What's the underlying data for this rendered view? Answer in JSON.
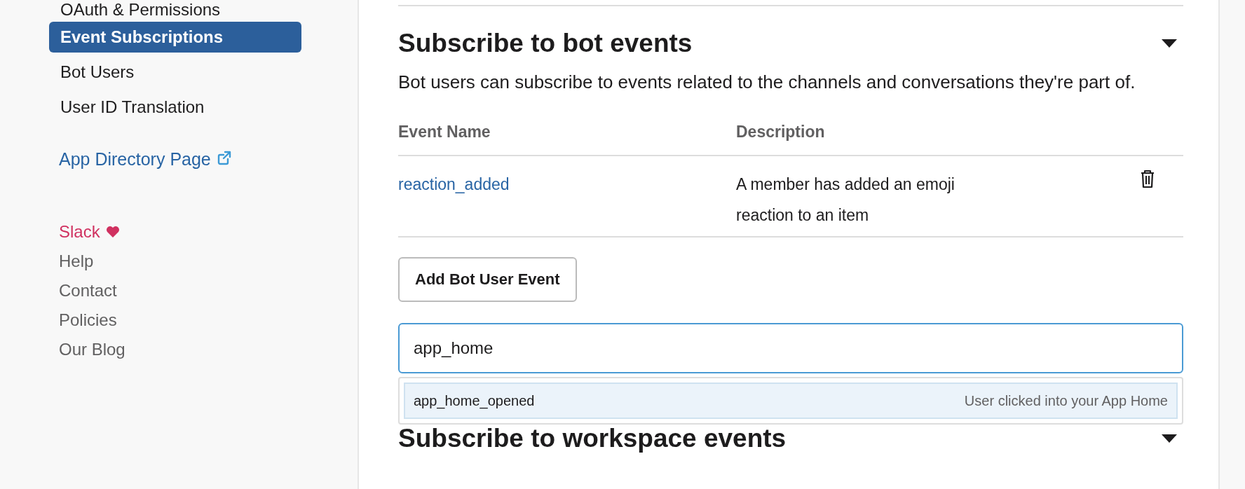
{
  "sidebar": {
    "items": [
      {
        "label": "OAuth & Permissions",
        "selected": false
      },
      {
        "label": "Event Subscriptions",
        "selected": true
      },
      {
        "label": "Bot Users",
        "selected": false
      },
      {
        "label": "User ID Translation",
        "selected": false
      }
    ],
    "directory_link": {
      "label": "App Directory Page"
    },
    "footer": [
      {
        "label": "Slack",
        "kind": "brand"
      },
      {
        "label": "Help",
        "kind": "link"
      },
      {
        "label": "Contact",
        "kind": "link"
      },
      {
        "label": "Policies",
        "kind": "link"
      },
      {
        "label": "Our Blog",
        "kind": "link"
      }
    ]
  },
  "sections": [
    {
      "title": "Subscribe to bot events",
      "expanded": true,
      "description": "Bot users can subscribe to events related to the channels and conversations they're part of.",
      "table": {
        "columns": [
          "Event Name",
          "Description"
        ],
        "rows": [
          {
            "event": "reaction_added",
            "description": "A member has added an emoji reaction to an item"
          }
        ]
      },
      "add_button": "Add Bot User Event",
      "search": {
        "value": "app_home"
      },
      "suggestions": [
        {
          "name": "app_home_opened",
          "description": "User clicked into your App Home",
          "selected": true
        }
      ]
    },
    {
      "title": "Subscribe to workspace events",
      "expanded": true
    }
  ]
}
